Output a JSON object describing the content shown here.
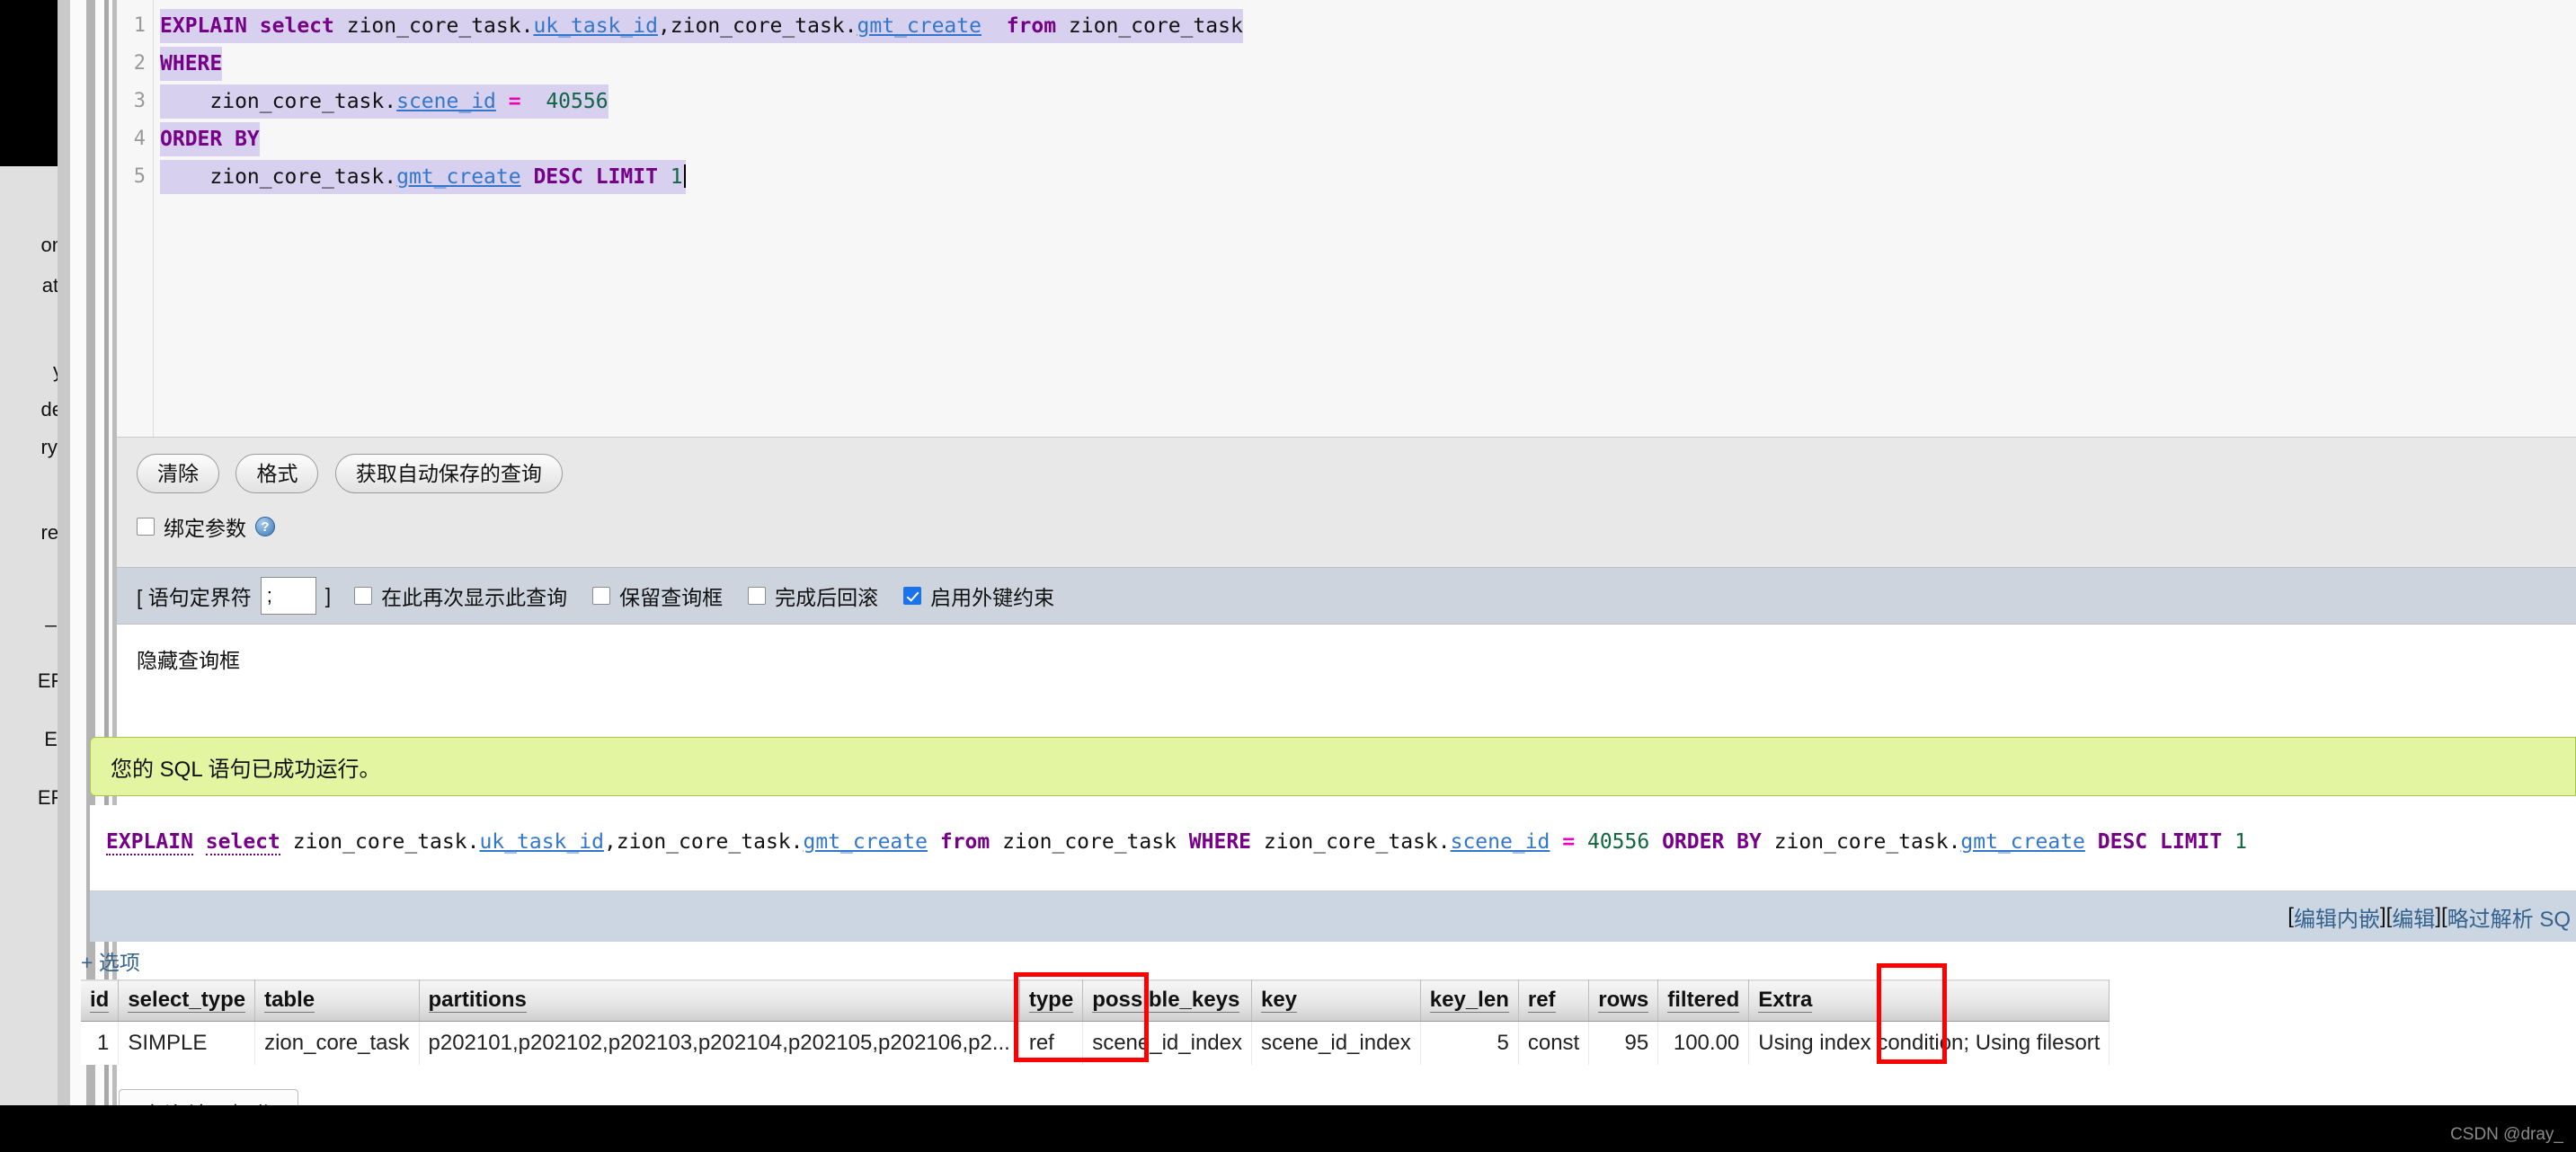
{
  "editor": {
    "lines": [
      {
        "n": "1",
        "tokens": [
          {
            "t": "EXPLAIN",
            "c": "kw"
          },
          {
            "t": " ",
            "c": "id"
          },
          {
            "t": "select",
            "c": "kw"
          },
          {
            "t": " zion_core_task.",
            "c": "id"
          },
          {
            "t": "uk_task_id",
            "c": "col"
          },
          {
            "t": ",zion_core_task.",
            "c": "id"
          },
          {
            "t": "gmt_create",
            "c": "col"
          },
          {
            "t": "  ",
            "c": "id"
          },
          {
            "t": "from",
            "c": "kw"
          },
          {
            "t": " zion_core_task",
            "c": "id"
          }
        ]
      },
      {
        "n": "2",
        "tokens": [
          {
            "t": "WHERE",
            "c": "kw"
          }
        ]
      },
      {
        "n": "3",
        "tokens": [
          {
            "t": "    zion_core_task.",
            "c": "id"
          },
          {
            "t": "scene_id",
            "c": "col"
          },
          {
            "t": " ",
            "c": "id"
          },
          {
            "t": "=",
            "c": "op"
          },
          {
            "t": "  ",
            "c": "id"
          },
          {
            "t": "40556",
            "c": "num"
          }
        ]
      },
      {
        "n": "4",
        "tokens": [
          {
            "t": "ORDER BY",
            "c": "kw"
          }
        ]
      },
      {
        "n": "5",
        "tokens": [
          {
            "t": "    zion_core_task.",
            "c": "id"
          },
          {
            "t": "gmt_create",
            "c": "col"
          },
          {
            "t": " ",
            "c": "id"
          },
          {
            "t": "DESC LIMIT",
            "c": "kw"
          },
          {
            "t": " ",
            "c": "id"
          },
          {
            "t": "1",
            "c": "num"
          }
        ]
      }
    ]
  },
  "toolbar": {
    "clear_label": "清除",
    "format_label": "格式",
    "autosave_label": "获取自动保存的查询",
    "bind_params_label": "绑定参数",
    "bind_params_checked": false,
    "help_icon_glyph": "?"
  },
  "delimiter_row": {
    "open_bracket": "[ 语句定界符",
    "value": ";",
    "close_bracket": "]",
    "checkboxes": [
      {
        "label": "在此再次显示此查询",
        "checked": false
      },
      {
        "label": "保留查询框",
        "checked": false
      },
      {
        "label": "完成后回滚",
        "checked": false
      },
      {
        "label": "启用外键约束",
        "checked": true
      }
    ]
  },
  "hide_query_box": {
    "label": "隐藏查询框"
  },
  "success": {
    "message": "您的 SQL 语句已成功运行。",
    "bg_color": "#e3f5a0",
    "border_color": "#a8c64a"
  },
  "sql_echo": {
    "tokens": [
      {
        "t": "EXPLAIN",
        "c": "kwu"
      },
      {
        "t": " ",
        "c": "id"
      },
      {
        "t": "select",
        "c": "kwu"
      },
      {
        "t": " zion_core_task.",
        "c": "id"
      },
      {
        "t": "uk_task_id",
        "c": "col"
      },
      {
        "t": ",zion_core_task.",
        "c": "id"
      },
      {
        "t": "gmt_create",
        "c": "col"
      },
      {
        "t": " ",
        "c": "id"
      },
      {
        "t": "from",
        "c": "kw"
      },
      {
        "t": " zion_core_task ",
        "c": "id"
      },
      {
        "t": "WHERE",
        "c": "kw"
      },
      {
        "t": " zion_core_task.",
        "c": "id"
      },
      {
        "t": "scene_id",
        "c": "col"
      },
      {
        "t": " ",
        "c": "id"
      },
      {
        "t": "=",
        "c": "op"
      },
      {
        "t": " ",
        "c": "id"
      },
      {
        "t": "40556",
        "c": "num"
      },
      {
        "t": " ",
        "c": "id"
      },
      {
        "t": "ORDER BY",
        "c": "kw"
      },
      {
        "t": " zion_core_task.",
        "c": "id"
      },
      {
        "t": "gmt_create",
        "c": "col"
      },
      {
        "t": " ",
        "c": "id"
      },
      {
        "t": "DESC LIMIT",
        "c": "kw"
      },
      {
        "t": " ",
        "c": "id"
      },
      {
        "t": "1",
        "c": "num"
      }
    ]
  },
  "action_links": [
    {
      "open": "[",
      "label": "编辑内嵌",
      "close": "]"
    },
    {
      "open": "[ ",
      "label": "编辑",
      "close": " ]"
    },
    {
      "open": "[ ",
      "label": "略过解析 SQ",
      "close": ""
    }
  ],
  "options": {
    "label": "+ 选项"
  },
  "results": {
    "columns": [
      "id",
      "select_type",
      "table",
      "partitions",
      "type",
      "possible_keys",
      "key",
      "key_len",
      "ref",
      "rows",
      "filtered",
      "Extra"
    ],
    "rows": [
      {
        "id": "1",
        "select_type": "SIMPLE",
        "table": "zion_core_task",
        "partitions": "p202101,p202102,p202103,p202104,p202105,p202106,p2...",
        "type": "ref",
        "possible_keys": "scene_id_index",
        "key": "scene_id_index",
        "key_len": "5",
        "ref": "const",
        "rows": "95",
        "filtered": "100.00",
        "Extra": "Using index condition; Using filesort"
      }
    ]
  },
  "annotations": {
    "highlight_color": "#ff0000",
    "boxes": [
      "type-column",
      "rows-column"
    ]
  },
  "result_ops": {
    "label": "查询结果操作"
  },
  "sidebar_clipped": [
    "on",
    "ati",
    "y",
    "de",
    "ry:",
    "rel",
    "_r",
    "EF",
    "EI",
    "EF"
  ],
  "watermark": {
    "text": "CSDN @dray_"
  }
}
